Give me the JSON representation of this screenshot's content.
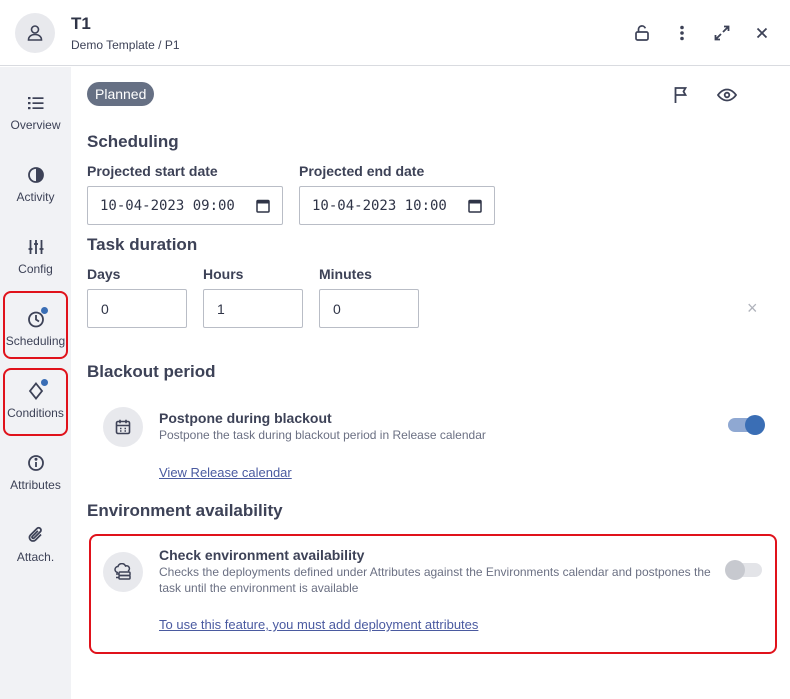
{
  "header": {
    "title": "T1",
    "breadcrumb": "Demo Template / P1",
    "icons": [
      "user-icon",
      "unlock-icon",
      "more-vertical-icon",
      "expand-icon",
      "close-icon"
    ]
  },
  "sidebar": {
    "items": [
      {
        "label": "Overview",
        "icon": "list-icon",
        "has_indicator": false
      },
      {
        "label": "Activity",
        "icon": "activity-icon",
        "has_indicator": false
      },
      {
        "label": "Config",
        "icon": "sliders-icon",
        "has_indicator": false
      },
      {
        "label": "Scheduling",
        "icon": "clock-icon",
        "has_indicator": true
      },
      {
        "label": "Conditions",
        "icon": "diamond-icon",
        "has_indicator": true
      },
      {
        "label": "Attributes",
        "icon": "info-icon",
        "has_indicator": false
      },
      {
        "label": "Attach.",
        "icon": "paperclip-icon",
        "has_indicator": false
      }
    ]
  },
  "status_badge": "Planned",
  "scheduling": {
    "heading": "Scheduling",
    "start_label": "Projected start date",
    "start_value": "10-04-2023 09:00",
    "end_label": "Projected end date",
    "end_value": "10-04-2023 10:00"
  },
  "duration": {
    "heading": "Task duration",
    "days_label": "Days",
    "days_value": "0",
    "hours_label": "Hours",
    "hours_value": "1",
    "minutes_label": "Minutes",
    "minutes_value": "0",
    "clear_symbol": "×"
  },
  "blackout": {
    "heading": "Blackout period",
    "option_title": "Postpone during blackout",
    "option_desc": "Postpone the task during blackout period in Release calendar",
    "toggle_on": true,
    "link": "View Release calendar"
  },
  "environment": {
    "heading": "Environment availability",
    "option_title": "Check environment availability",
    "option_desc": "Checks the deployments defined under Attributes against the Environments calendar and postpones the task until the environment is available",
    "toggle_on": false,
    "link": "To use this feature, you must add deployment attributes"
  },
  "colors": {
    "accent": "#3a6eb5",
    "highlight": "#e0121b",
    "badge": "#667084",
    "sidebar_bg": "#f1f2f5"
  }
}
